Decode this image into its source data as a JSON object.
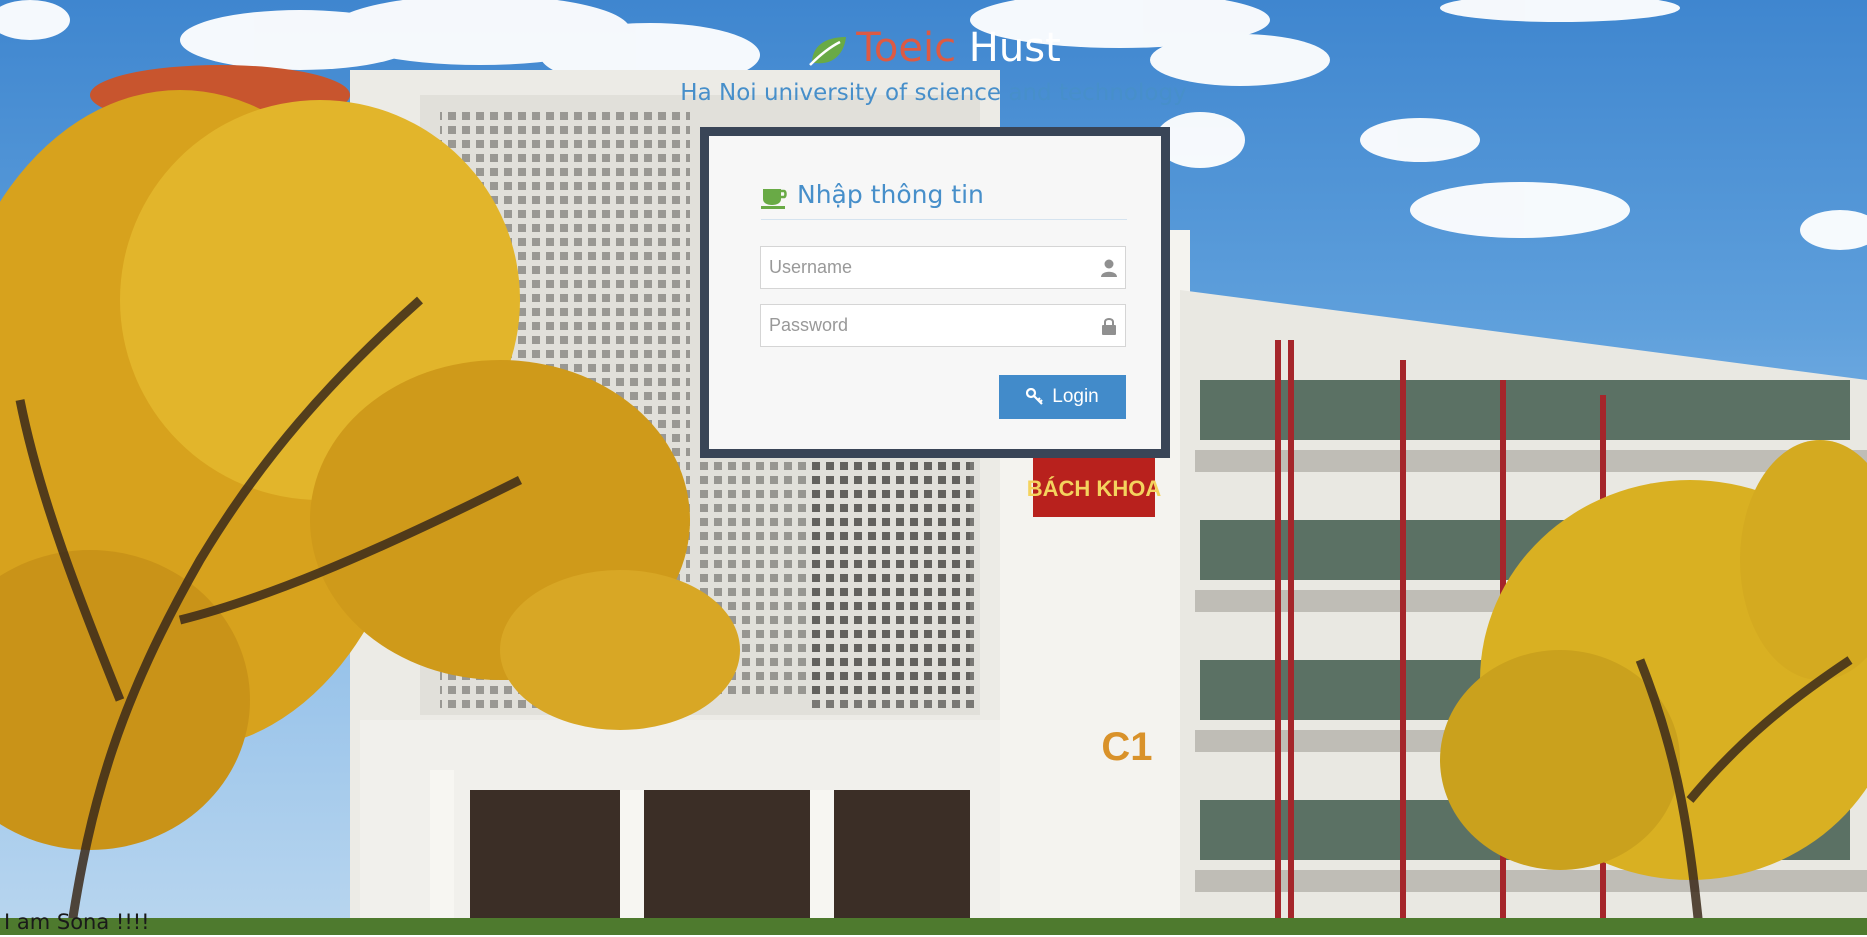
{
  "brand": {
    "part1": "Toeic",
    "part2": "Hust",
    "subtitle": "Ha Noi university of science and technology",
    "accent_red": "#dd5a43",
    "accent_blue": "#478fca",
    "icon": "leaf-icon"
  },
  "login": {
    "title": "Nhập thông tin",
    "title_icon": "coffee-icon",
    "username_placeholder": "Username",
    "username_icon": "user-icon",
    "password_placeholder": "Password",
    "password_icon": "lock-icon",
    "button_label": "Login",
    "button_icon": "key-icon",
    "button_color": "#428bca",
    "frame_color": "#394557"
  },
  "background": {
    "sign_text": "BÁCH KHOA",
    "building_label": "C1"
  },
  "footer": {
    "text": "I am Sona !!!!"
  }
}
